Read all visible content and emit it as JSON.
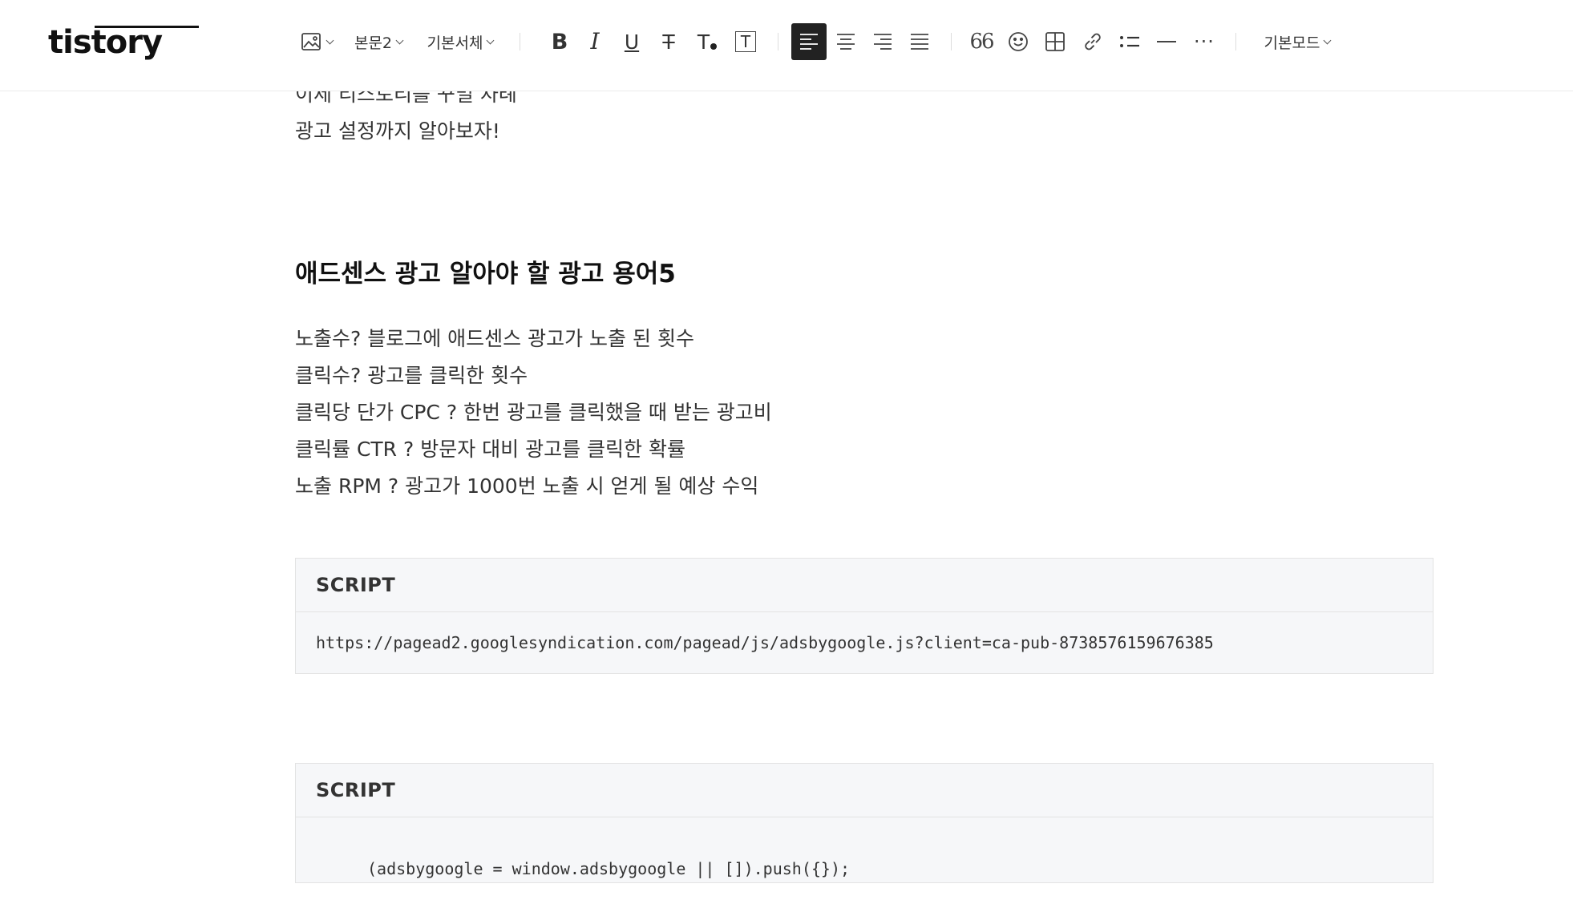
{
  "app": {
    "logo_text": "tistory"
  },
  "toolbar": {
    "image_button": "image-insert",
    "paragraph_style": "본문2",
    "font_family": "기본서체",
    "bold_label": "B",
    "italic_label": "I",
    "underline_label": "U",
    "strike_label": "T",
    "text_color_label": "T",
    "text_bg_label": "T",
    "quote_label": "66",
    "more_label": "···",
    "mode_label": "기본모드",
    "active_align": "left",
    "active_color": "#222222"
  },
  "document": {
    "intro_lines": [
      "이제 티스토리를 꾸밀 차례",
      "광고 설정까지 알아보자!"
    ],
    "heading": "애드센스 광고 알아야 할 광고 용어5",
    "terms": [
      "노출수? 블로그에 애드센스 광고가 노출 된 횟수",
      "클릭수? 광고를 클릭한 횟수",
      "클릭당 단가 CPC ? 한번 광고를 클릭했을 때 받는 광고비",
      "클릭률 CTR ? 방문자 대비 광고를 클릭한 확률",
      "노출 RPM ? 광고가 1000번 노출 시 얻게 될 예상 수익"
    ],
    "code_blocks": [
      {
        "label": "SCRIPT",
        "code": "https://pagead2.googlesyndication.com/pagead/js/adsbygoogle.js?client=ca-pub-8738576159676385"
      },
      {
        "label": "SCRIPT",
        "code": "(adsbygoogle = window.adsbygoogle || []).push({});"
      }
    ]
  }
}
